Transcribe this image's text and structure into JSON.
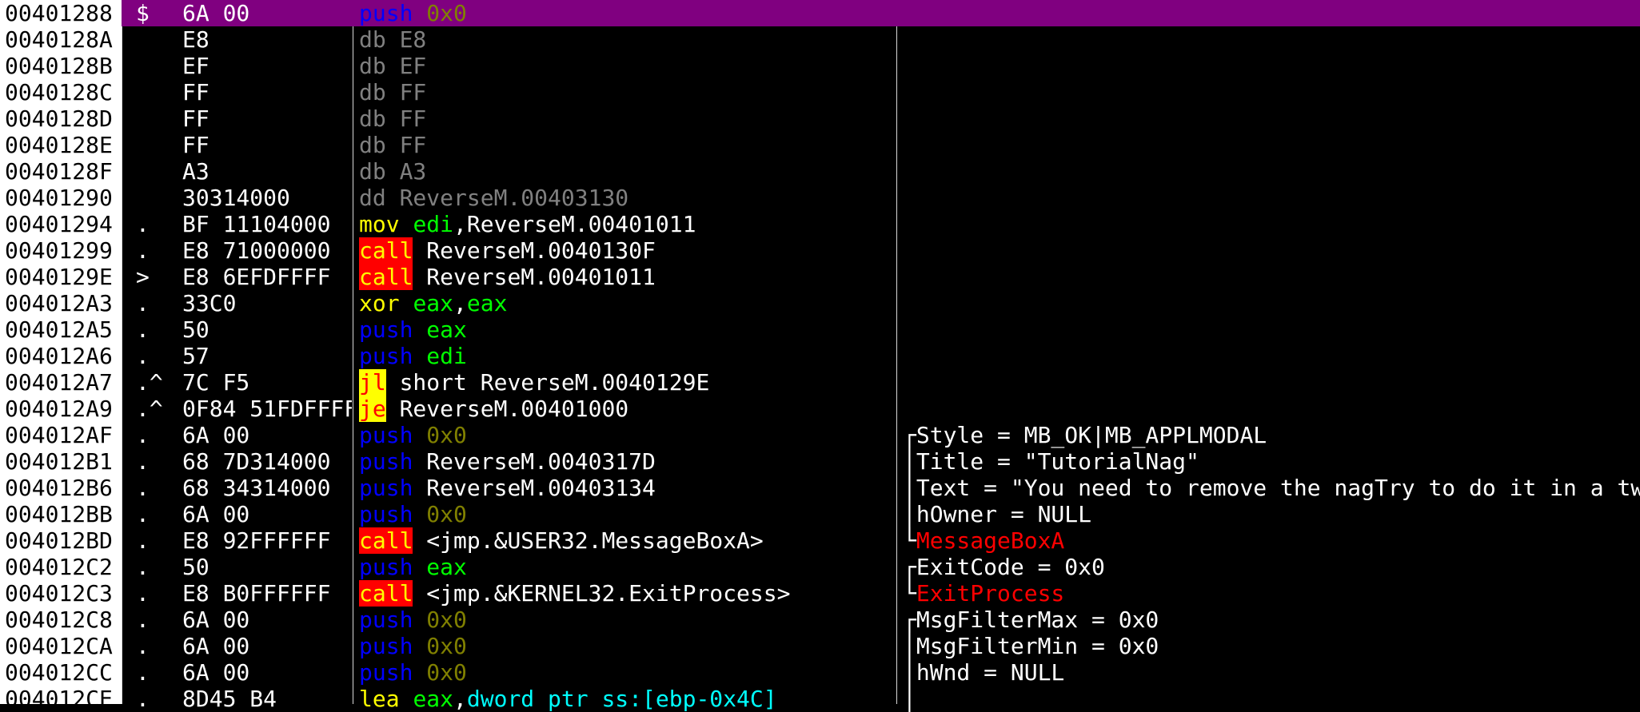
{
  "rows": [
    {
      "addr": "00401288",
      "mark": "$",
      "hex": "6A 00",
      "op": "push",
      "arg": "0x0",
      "comment": "",
      "bracket": ""
    },
    {
      "addr": "0040128A",
      "mark": "",
      "hex": "E8",
      "op": "db",
      "arg": "E8",
      "comment": "",
      "bracket": ""
    },
    {
      "addr": "0040128B",
      "mark": "",
      "hex": "EF",
      "op": "db",
      "arg": "EF",
      "comment": "",
      "bracket": ""
    },
    {
      "addr": "0040128C",
      "mark": "",
      "hex": "FF",
      "op": "db",
      "arg": "FF",
      "comment": "",
      "bracket": ""
    },
    {
      "addr": "0040128D",
      "mark": "",
      "hex": "FF",
      "op": "db",
      "arg": "FF",
      "comment": "",
      "bracket": ""
    },
    {
      "addr": "0040128E",
      "mark": "",
      "hex": "FF",
      "op": "db",
      "arg": "FF",
      "comment": "",
      "bracket": ""
    },
    {
      "addr": "0040128F",
      "mark": "",
      "hex": "A3",
      "op": "db",
      "arg": "A3",
      "comment": "",
      "bracket": ""
    },
    {
      "addr": "00401290",
      "mark": "",
      "hex": "30314000",
      "op": "dd",
      "arg": "ReverseM.00403130",
      "comment": "",
      "bracket": ""
    },
    {
      "addr": "00401294",
      "mark": ".",
      "hex": "BF 11104000",
      "op": "mov",
      "arg": "edi,ReverseM.00401011",
      "comment": "",
      "bracket": ""
    },
    {
      "addr": "00401299",
      "mark": ".",
      "hex": "E8 71000000",
      "op": "call",
      "arg": "ReverseM.0040130F",
      "comment": "",
      "bracket": ""
    },
    {
      "addr": "0040129E",
      "mark": ">",
      "hex": "E8 6EFDFFFF",
      "op": "call",
      "arg": "ReverseM.00401011",
      "comment": "",
      "bracket": ""
    },
    {
      "addr": "004012A3",
      "mark": ".",
      "hex": "33C0",
      "op": "xor",
      "arg": "eax,eax",
      "comment": "",
      "bracket": ""
    },
    {
      "addr": "004012A5",
      "mark": ".",
      "hex": "50",
      "op": "push",
      "arg": "eax",
      "comment": "",
      "bracket": ""
    },
    {
      "addr": "004012A6",
      "mark": ".",
      "hex": "57",
      "op": "push",
      "arg": "edi",
      "comment": "",
      "bracket": ""
    },
    {
      "addr": "004012A7",
      "mark": ".^",
      "hex": "7C F5",
      "op": "jl",
      "arg": "short ReverseM.0040129E",
      "comment": "",
      "bracket": ""
    },
    {
      "addr": "004012A9",
      "mark": ".^",
      "hex": "0F84 51FDFFFF",
      "op": "je",
      "arg": "ReverseM.00401000",
      "comment": "",
      "bracket": ""
    },
    {
      "addr": "004012AF",
      "mark": ".",
      "hex": "6A 00",
      "op": "push",
      "arg": "0x0",
      "comment": "Style = MB_OK|MB_APPLMODAL",
      "bracket": "┌"
    },
    {
      "addr": "004012B1",
      "mark": ".",
      "hex": "68 7D314000",
      "op": "push",
      "arg": "ReverseM.0040317D",
      "comment": "Title = \"TutorialNag\"",
      "bracket": "│"
    },
    {
      "addr": "004012B6",
      "mark": ".",
      "hex": "68 34314000",
      "op": "push",
      "arg": "ReverseM.00403134",
      "comment": "Text = \"You need to remove the nagTry to do it in a tw",
      "bracket": "│"
    },
    {
      "addr": "004012BB",
      "mark": ".",
      "hex": "6A 00",
      "op": "push",
      "arg": "0x0",
      "comment": "hOwner = NULL",
      "bracket": "│"
    },
    {
      "addr": "004012BD",
      "mark": ".",
      "hex": "E8 92FFFFFF",
      "op": "call",
      "arg": "<jmp.&USER32.MessageBoxA>",
      "comment": "MessageBoxA",
      "bracket": "└"
    },
    {
      "addr": "004012C2",
      "mark": ".",
      "hex": "50",
      "op": "push",
      "arg": "eax",
      "comment": "ExitCode = 0x0",
      "bracket": "┌"
    },
    {
      "addr": "004012C3",
      "mark": ".",
      "hex": "E8 B0FFFFFF",
      "op": "call",
      "arg": "<jmp.&KERNEL32.ExitProcess>",
      "comment": "ExitProcess",
      "bracket": "└"
    },
    {
      "addr": "004012C8",
      "mark": ".",
      "hex": "6A 00",
      "op": "push",
      "arg": "0x0",
      "comment": "MsgFilterMax = 0x0",
      "bracket": "┌"
    },
    {
      "addr": "004012CA",
      "mark": ".",
      "hex": "6A 00",
      "op": "push",
      "arg": "0x0",
      "comment": "MsgFilterMin = 0x0",
      "bracket": "│"
    },
    {
      "addr": "004012CC",
      "mark": ".",
      "hex": "6A 00",
      "op": "push",
      "arg": "0x0",
      "comment": "hWnd = NULL",
      "bracket": "│"
    },
    {
      "addr": "004012CE",
      "mark": ".",
      "hex": "8D45 B4",
      "op": "lea",
      "arg": "eax,dword ptr ss:[ebp-0x4C]",
      "comment": "",
      "bracket": "│"
    }
  ],
  "colors": {
    "selected_row": "#800080",
    "call_bg": "#ff0000",
    "jcc_bg": "#ffff00",
    "push": "#0000ff",
    "register": "#00ff00",
    "immediate": "#808000",
    "api_name": "#ff0000"
  }
}
